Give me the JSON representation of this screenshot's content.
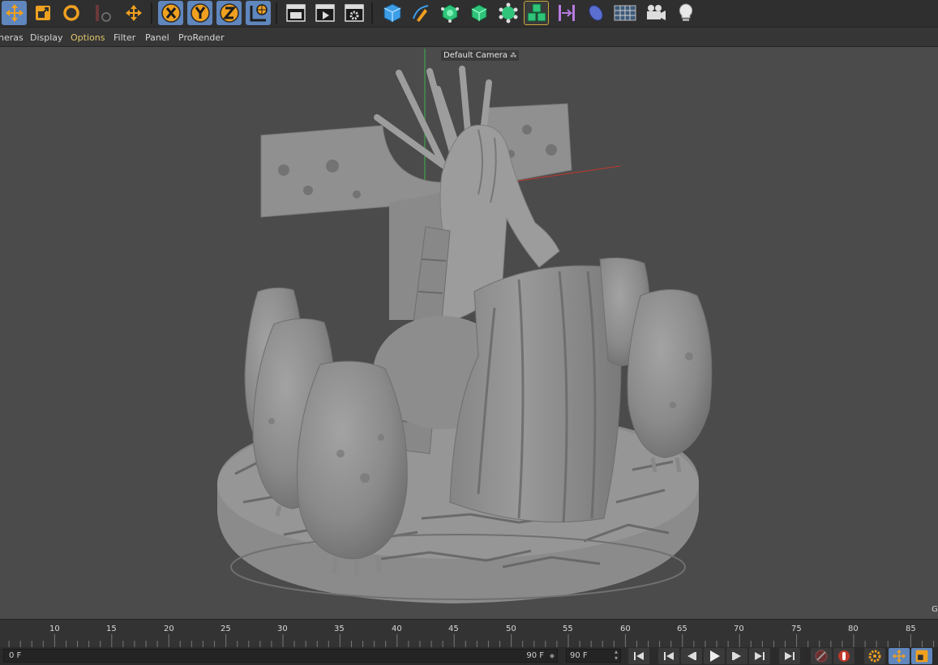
{
  "menu": {
    "items": [
      {
        "label": "neras",
        "active": false
      },
      {
        "label": "Display",
        "active": false
      },
      {
        "label": "Options",
        "active": true
      },
      {
        "label": "Filter",
        "active": false
      },
      {
        "label": "Panel",
        "active": false
      },
      {
        "label": "ProRender",
        "active": false
      }
    ]
  },
  "toolbar": {
    "buttons": [
      {
        "icon": "move-icon",
        "active": true
      },
      {
        "icon": "scale-icon",
        "active": false
      },
      {
        "icon": "rotate-icon",
        "active": false
      },
      {
        "icon": "recent-tool-icon",
        "active": false
      },
      {
        "icon": "move-arrows-icon",
        "active": false
      },
      {
        "icon": "x-axis-lock-icon",
        "active": true
      },
      {
        "icon": "y-axis-lock-icon",
        "active": true
      },
      {
        "icon": "z-axis-lock-icon",
        "active": true
      },
      {
        "icon": "coordinate-system-icon",
        "active": true
      },
      {
        "icon": "render-view-icon",
        "active": false
      },
      {
        "icon": "render-picture-viewer-icon",
        "active": false
      },
      {
        "icon": "render-settings-icon",
        "active": false
      },
      {
        "icon": "cube-icon",
        "active": false
      },
      {
        "icon": "pen-icon",
        "active": false
      },
      {
        "icon": "subdivision-icon",
        "active": false
      },
      {
        "icon": "extrude-icon",
        "active": false
      },
      {
        "icon": "cloner-icon",
        "active": false
      },
      {
        "icon": "mograph-icon",
        "active": false
      },
      {
        "icon": "deformer-icon",
        "active": false
      },
      {
        "icon": "field-icon",
        "active": false
      },
      {
        "icon": "floor-icon",
        "active": false
      },
      {
        "icon": "camera-icon",
        "active": false
      },
      {
        "icon": "light-icon",
        "active": false
      }
    ]
  },
  "viewport": {
    "camera_label": "Default Camera",
    "grid_label": "Gr"
  },
  "timeline": {
    "ticks": [
      "10",
      "15",
      "20",
      "25",
      "30",
      "35",
      "40",
      "45",
      "50",
      "55",
      "60",
      "65",
      "70",
      "75",
      "80",
      "85"
    ],
    "start_frame": "0 F",
    "end_frame": "90 F",
    "max_frame": "90 F"
  },
  "colors": {
    "accent": "#5f86bd",
    "menu_active": "#e0c66a",
    "viewport_bg": "#4b4b4b",
    "model": "#8a8a8a"
  }
}
